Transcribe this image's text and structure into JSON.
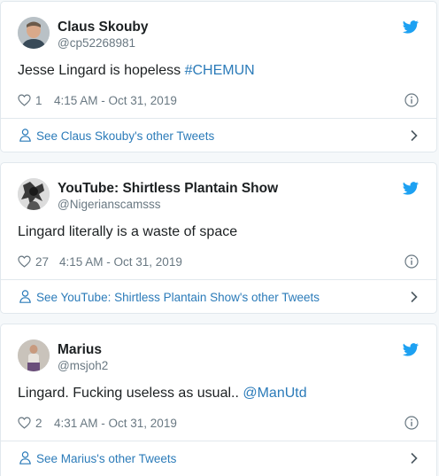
{
  "colors": {
    "background": "#f5f8fa",
    "card": "#ffffff",
    "border": "#e1e8ed",
    "name": "#1c2022",
    "muted": "#697882",
    "link": "#2b7bb9",
    "twitter_bird": "#1da1f2"
  },
  "icons": {
    "bird": "twitter-bird-icon",
    "heart": "heart-icon",
    "info": "info-icon",
    "person": "person-icon",
    "chevron": "chevron-right-icon"
  },
  "tweets": [
    {
      "name": "Claus Skouby",
      "handle": "@cp52268981",
      "text": "Jesse Lingard is hopeless ",
      "link_text": "#CHEMUN",
      "likes": "1",
      "time": "4:15 AM - Oct 31, 2019",
      "more": "See Claus Skouby's other Tweets"
    },
    {
      "name": "YouTube: Shirtless Plantain Show",
      "handle": "@Nigerianscamsss",
      "text": "Lingard literally is a waste of space",
      "link_text": "",
      "likes": "27",
      "time": "4:15 AM - Oct 31, 2019",
      "more": "See YouTube: Shirtless Plantain Show's other Tweets"
    },
    {
      "name": "Marius",
      "handle": "@msjoh2",
      "text": "Lingard. Fucking useless as usual.. ",
      "link_text": "@ManUtd",
      "likes": "2",
      "time": "4:31 AM - Oct 31, 2019",
      "more": "See Marius's other Tweets"
    }
  ]
}
